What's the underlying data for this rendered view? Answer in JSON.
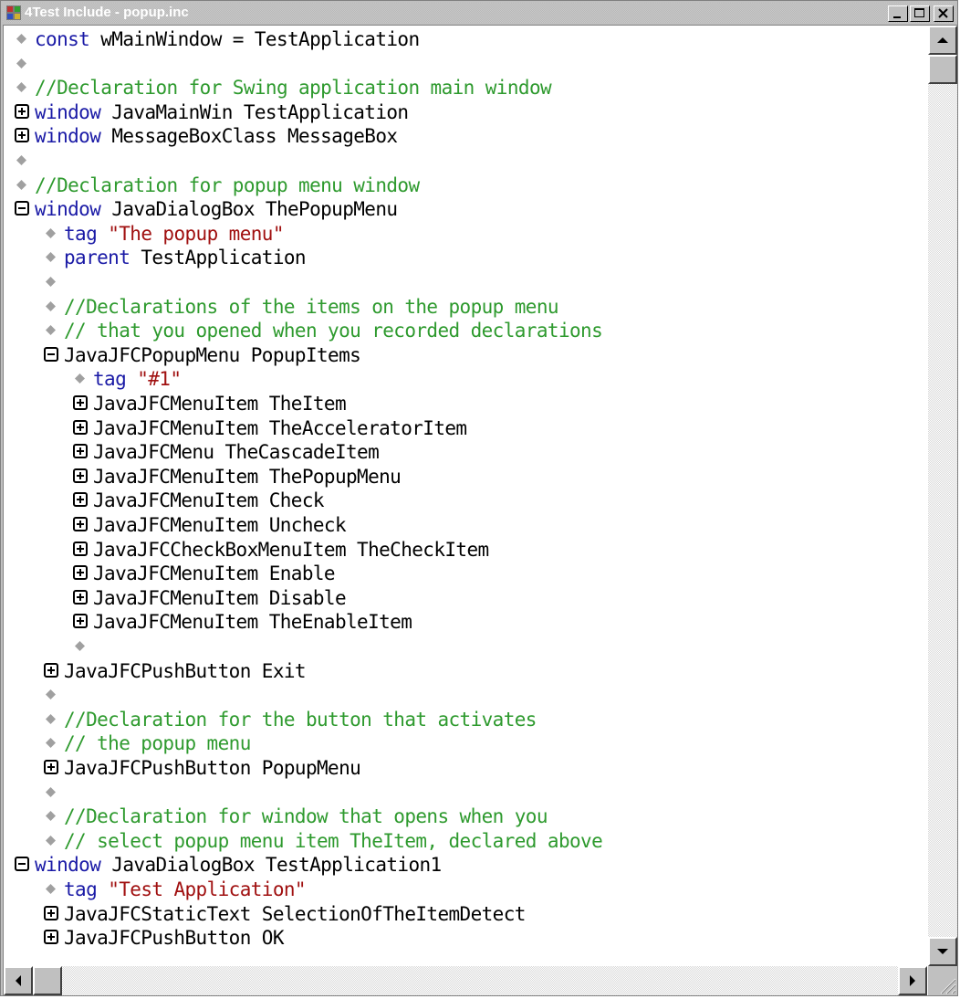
{
  "window": {
    "title": "4Test Include - popup.inc"
  },
  "icons": {
    "app": "app-icon",
    "minimize": "minimize-icon",
    "maximize": "maximize-icon",
    "close": "close-icon",
    "expand": "expand-plus-icon",
    "collapse": "collapse-minus-icon",
    "bullet": "diamond-bullet-icon"
  },
  "colors": {
    "keyword": "#1a1aa6",
    "comment": "#2e9a2e",
    "string": "#a01010",
    "text": "#000000",
    "titlebar_text": "#ffffff"
  },
  "lines": [
    {
      "indent": 0,
      "marker": "bullet",
      "segments": [
        {
          "t": "const ",
          "k": "kw"
        },
        {
          "t": "wMainWindow = TestApplication",
          "k": "id"
        }
      ]
    },
    {
      "indent": 0,
      "marker": "bullet",
      "segments": []
    },
    {
      "indent": 0,
      "marker": "bullet",
      "segments": [
        {
          "t": "//Declaration for Swing application main window",
          "k": "cm"
        }
      ]
    },
    {
      "indent": 0,
      "marker": "plus",
      "segments": [
        {
          "t": "window ",
          "k": "kw"
        },
        {
          "t": "JavaMainWin TestApplication",
          "k": "id"
        }
      ]
    },
    {
      "indent": 0,
      "marker": "plus",
      "segments": [
        {
          "t": "window ",
          "k": "kw"
        },
        {
          "t": "MessageBoxClass MessageBox",
          "k": "id"
        }
      ]
    },
    {
      "indent": 0,
      "marker": "bullet",
      "segments": []
    },
    {
      "indent": 0,
      "marker": "bullet",
      "segments": [
        {
          "t": "//Declaration for popup menu window",
          "k": "cm"
        }
      ]
    },
    {
      "indent": 0,
      "marker": "minus",
      "segments": [
        {
          "t": "window ",
          "k": "kw"
        },
        {
          "t": "JavaDialogBox ThePopupMenu",
          "k": "id"
        }
      ]
    },
    {
      "indent": 1,
      "marker": "bullet",
      "segments": [
        {
          "t": "tag ",
          "k": "kw"
        },
        {
          "t": "\"The popup menu\"",
          "k": "st"
        }
      ]
    },
    {
      "indent": 1,
      "marker": "bullet",
      "segments": [
        {
          "t": "parent ",
          "k": "kw"
        },
        {
          "t": "TestApplication",
          "k": "id"
        }
      ]
    },
    {
      "indent": 1,
      "marker": "bullet",
      "segments": []
    },
    {
      "indent": 1,
      "marker": "bullet",
      "segments": [
        {
          "t": "//Declarations of the items on the popup menu",
          "k": "cm"
        }
      ]
    },
    {
      "indent": 1,
      "marker": "bullet",
      "segments": [
        {
          "t": "// that you opened when you recorded declarations",
          "k": "cm"
        }
      ]
    },
    {
      "indent": 1,
      "marker": "minus",
      "segments": [
        {
          "t": "JavaJFCPopupMenu PopupItems",
          "k": "id"
        }
      ]
    },
    {
      "indent": 2,
      "marker": "bullet",
      "segments": [
        {
          "t": "tag ",
          "k": "kw"
        },
        {
          "t": "\"#1\"",
          "k": "st"
        }
      ]
    },
    {
      "indent": 2,
      "marker": "plus",
      "segments": [
        {
          "t": "JavaJFCMenuItem TheItem",
          "k": "id"
        }
      ]
    },
    {
      "indent": 2,
      "marker": "plus",
      "segments": [
        {
          "t": "JavaJFCMenuItem TheAcceleratorItem",
          "k": "id"
        }
      ]
    },
    {
      "indent": 2,
      "marker": "plus",
      "segments": [
        {
          "t": "JavaJFCMenu TheCascadeItem",
          "k": "id"
        }
      ]
    },
    {
      "indent": 2,
      "marker": "plus",
      "segments": [
        {
          "t": "JavaJFCMenuItem ThePopupMenu",
          "k": "id"
        }
      ]
    },
    {
      "indent": 2,
      "marker": "plus",
      "segments": [
        {
          "t": "JavaJFCMenuItem Check",
          "k": "id"
        }
      ]
    },
    {
      "indent": 2,
      "marker": "plus",
      "segments": [
        {
          "t": "JavaJFCMenuItem Uncheck",
          "k": "id"
        }
      ]
    },
    {
      "indent": 2,
      "marker": "plus",
      "segments": [
        {
          "t": "JavaJFCCheckBoxMenuItem TheCheckItem",
          "k": "id"
        }
      ]
    },
    {
      "indent": 2,
      "marker": "plus",
      "segments": [
        {
          "t": "JavaJFCMenuItem Enable",
          "k": "id"
        }
      ]
    },
    {
      "indent": 2,
      "marker": "plus",
      "segments": [
        {
          "t": "JavaJFCMenuItem Disable",
          "k": "id"
        }
      ]
    },
    {
      "indent": 2,
      "marker": "plus",
      "segments": [
        {
          "t": "JavaJFCMenuItem TheEnableItem",
          "k": "id"
        }
      ]
    },
    {
      "indent": 2,
      "marker": "bullet",
      "segments": []
    },
    {
      "indent": 1,
      "marker": "plus",
      "segments": [
        {
          "t": "JavaJFCPushButton Exit",
          "k": "id"
        }
      ]
    },
    {
      "indent": 1,
      "marker": "bullet",
      "segments": []
    },
    {
      "indent": 1,
      "marker": "bullet",
      "segments": [
        {
          "t": "//Declaration for the button that activates",
          "k": "cm"
        }
      ]
    },
    {
      "indent": 1,
      "marker": "bullet",
      "segments": [
        {
          "t": "// the popup menu",
          "k": "cm"
        }
      ]
    },
    {
      "indent": 1,
      "marker": "plus",
      "segments": [
        {
          "t": "JavaJFCPushButton PopupMenu",
          "k": "id"
        }
      ]
    },
    {
      "indent": 1,
      "marker": "bullet",
      "segments": []
    },
    {
      "indent": 1,
      "marker": "bullet",
      "segments": [
        {
          "t": "//Declaration for window that opens when you",
          "k": "cm"
        }
      ]
    },
    {
      "indent": 1,
      "marker": "bullet",
      "segments": [
        {
          "t": "// select popup menu item TheItem, declared above",
          "k": "cm"
        }
      ]
    },
    {
      "indent": 0,
      "marker": "minus",
      "segments": [
        {
          "t": "window ",
          "k": "kw"
        },
        {
          "t": "JavaDialogBox TestApplication1",
          "k": "id"
        }
      ]
    },
    {
      "indent": 1,
      "marker": "bullet",
      "segments": [
        {
          "t": "tag ",
          "k": "kw"
        },
        {
          "t": "\"Test Application\"",
          "k": "st"
        }
      ]
    },
    {
      "indent": 1,
      "marker": "plus",
      "segments": [
        {
          "t": "JavaJFCStaticText SelectionOfTheItemDetect",
          "k": "id"
        }
      ]
    },
    {
      "indent": 1,
      "marker": "plus",
      "segments": [
        {
          "t": "JavaJFCPushButton OK",
          "k": "id"
        }
      ]
    }
  ]
}
